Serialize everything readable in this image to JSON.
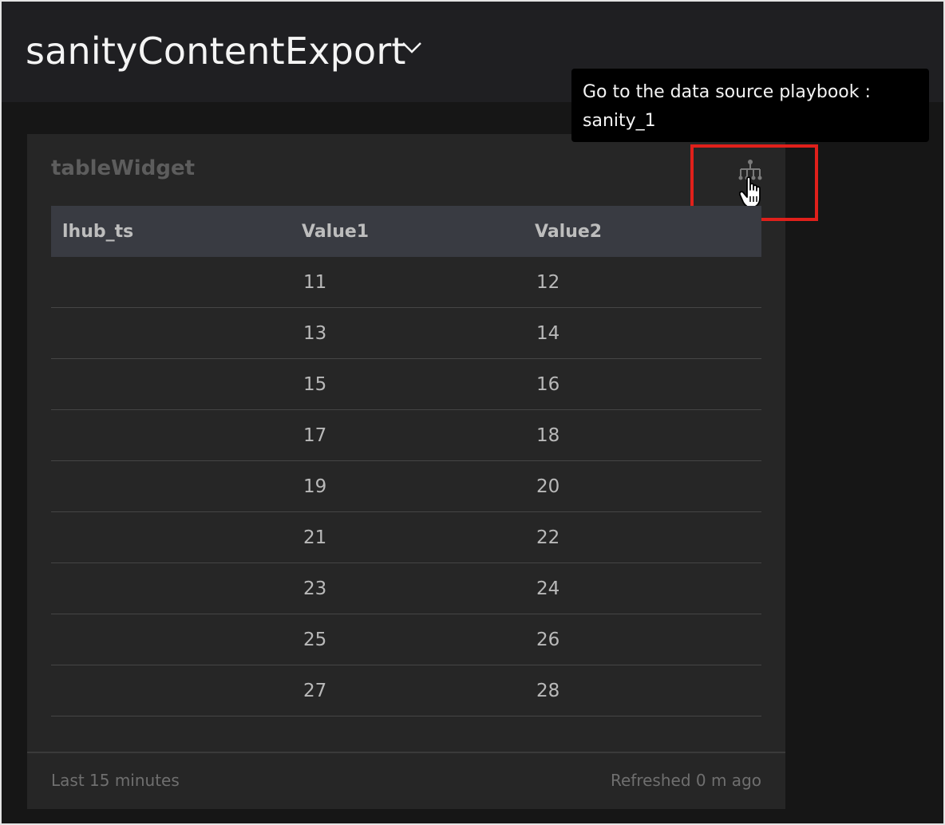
{
  "dashboard": {
    "title": "sanityContentExport"
  },
  "widget": {
    "title": "tableWidget",
    "columns": [
      "lhub_ts",
      "Value1",
      "Value2"
    ],
    "rows": [
      [
        "",
        "11",
        "12"
      ],
      [
        "",
        "13",
        "14"
      ],
      [
        "",
        "15",
        "16"
      ],
      [
        "",
        "17",
        "18"
      ],
      [
        "",
        "19",
        "20"
      ],
      [
        "",
        "21",
        "22"
      ],
      [
        "",
        "23",
        "24"
      ],
      [
        "",
        "25",
        "26"
      ],
      [
        "",
        "27",
        "28"
      ]
    ],
    "time_range": "Last 15 minutes",
    "refreshed": "Refreshed 0 m ago"
  },
  "tooltip": {
    "line1": "Go to the data source playbook :",
    "line2": "sanity_1"
  },
  "icons": {
    "title_dropdown": "chevron-down-icon",
    "playbook_link": "playbook-hierarchy-icon",
    "cursor": "hand-pointer-icon"
  },
  "colors": {
    "background": "#161616",
    "header": "#1f1f22",
    "widget": "#262626",
    "table_header": "#393b42",
    "highlight": "#e0201b",
    "tooltip": "#000000"
  }
}
